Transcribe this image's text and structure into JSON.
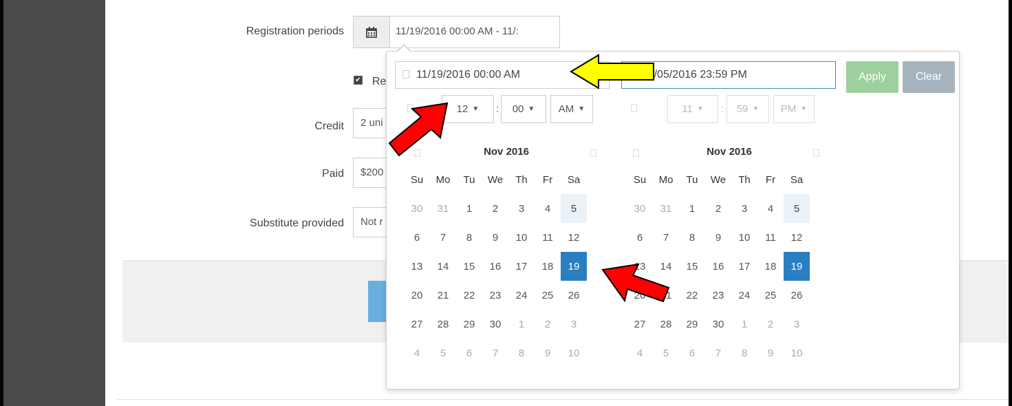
{
  "form": {
    "registration_label": "Registration periods",
    "range_value": "11/19/2016 00:00 AM - 11/:",
    "checkbox_text": "Rec",
    "credit_label": "Credit",
    "credit_value": "2 uni",
    "paid_label": "Paid",
    "paid_value": "$200",
    "substitute_label": "Substitute provided",
    "substitute_value": "Not r"
  },
  "picker": {
    "start_input": "11/19/2016 00:00 AM",
    "end_input": "11/05/2016 23:59 PM",
    "apply_label": "Apply",
    "clear_label": "Clear",
    "start_time": {
      "hour": "12",
      "minute": "00",
      "ampm": "AM"
    },
    "end_time": {
      "hour": "11",
      "minute": "59",
      "ampm": "PM"
    },
    "colon": ":",
    "arrow_glyph": "▼",
    "left_month": "Nov 2016",
    "right_month": "Nov 2016",
    "weekdays": [
      "Su",
      "Mo",
      "Tu",
      "We",
      "Th",
      "Fr",
      "Sa"
    ],
    "weeks": [
      [
        "30",
        "31",
        "1",
        "2",
        "3",
        "4",
        "5"
      ],
      [
        "6",
        "7",
        "8",
        "9",
        "10",
        "11",
        "12"
      ],
      [
        "13",
        "14",
        "15",
        "16",
        "17",
        "18",
        "19"
      ],
      [
        "20",
        "21",
        "22",
        "23",
        "24",
        "25",
        "26"
      ],
      [
        "27",
        "28",
        "29",
        "30",
        "1",
        "2",
        "3"
      ],
      [
        "4",
        "5",
        "6",
        "7",
        "8",
        "9",
        "10"
      ]
    ],
    "selected_day": "19",
    "highlighted_day": "5"
  },
  "colors": {
    "apply": "#9cd09c",
    "clear": "#a7b4bd",
    "selected": "#2a7fc1",
    "annotation_yellow": "#ffff00",
    "annotation_red": "#ff0000"
  }
}
